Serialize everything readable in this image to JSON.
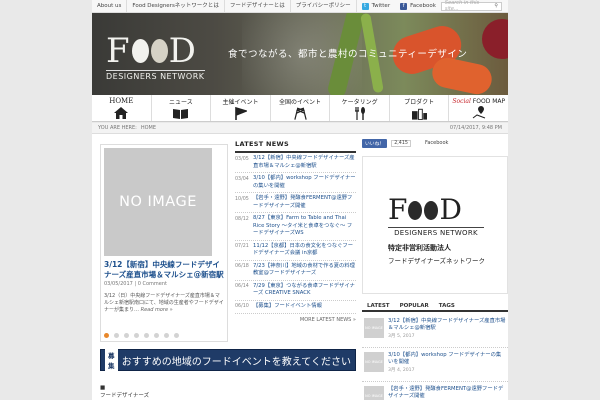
{
  "topbar": {
    "links": [
      "About us",
      "Food Designersネットワークとは",
      "フードデザイナーとは",
      "プライバシーポリシー"
    ],
    "twitter": "Twitter",
    "facebook": "Facebook",
    "search_placeholder": "Search in this site..."
  },
  "header": {
    "logo_word_left": "F",
    "logo_word_right": "D",
    "logo_sub": "DESIGNERS NETWORK",
    "tagline": "食でつながる、都市と農村のコミュニティーデザイン"
  },
  "nav": {
    "items": [
      {
        "label": "HOME",
        "icon": "house-icon"
      },
      {
        "label": "ニュース",
        "icon": "book-icon"
      },
      {
        "label": "主催イベント",
        "icon": "flag-icon"
      },
      {
        "label": "全国のイベント",
        "icon": "flags-icon"
      },
      {
        "label": "ケータリング",
        "icon": "cutlery-icon"
      },
      {
        "label": "プロダクト",
        "icon": "products-icon"
      },
      {
        "label_prefix": "Social",
        "label": "FOOD MAP",
        "icon": "map-pin-icon"
      }
    ]
  },
  "breadcrumb": {
    "prefix": "YOU ARE HERE:",
    "current": "HOME",
    "datetime": "07/14/2017, 9:48 PM"
  },
  "slider": {
    "placeholder": "NO IMAGE",
    "title": "3/12【新宿】中央線フードデザイナーズ産直市場＆マルシェ@新宿駅",
    "date": "03/05/2017",
    "comments": "0 Comment",
    "excerpt": "3/12（日）中央線フードデザイナーズ産直市場＆マルシェ新宿駅南口にて、地域の生産者やフードデザイナーが集まり…",
    "more": "Read more »",
    "dot_count": 8,
    "active_dot": 0
  },
  "latest_news": {
    "heading": "LATEST NEWS",
    "items": [
      {
        "date": "03/05",
        "title": "3/12【新宿】中央線フードデザイナーズ産直市場＆マルシェ@新宿駅"
      },
      {
        "date": "03/04",
        "title": "3/10【都内】workshop フードデザイナーの集いを開催"
      },
      {
        "date": "10/05",
        "title": "【岩手・遠野】発酵食FERMENT@遠野フードデザイナーズ開催"
      },
      {
        "date": "08/12",
        "title": "8/27【東京】Farm to Table and Thai Rice Story 〜タイ米と食卓をつなぐ〜 フードデザイナーズWS"
      },
      {
        "date": "07/21",
        "title": "11/12【京都】日本の食文化をつなぐフードデザイナーズ会議 in京都"
      },
      {
        "date": "06/18",
        "title": "7/23【神奈川】地域の食材で作る夏の料理教室@フードデザイナーズ"
      },
      {
        "date": "06/14",
        "title": "7/29【東京】つながる食卓フードデザイナーズ CREATIVE SNACK"
      },
      {
        "date": "06/10",
        "title": "【募集】フードイベント情報"
      }
    ],
    "more": "MORE LATEST NEWS »"
  },
  "cta_banner": {
    "tag": "募集",
    "text": "おすすめの地域のフードイベントを教えてください"
  },
  "below": {
    "line1": "■",
    "line2": "フードデザイナーズ"
  },
  "sidebar": {
    "fb_like": "いいね！",
    "fb_count": "2,415",
    "fb_share": "Facebook",
    "logo_word_left": "F",
    "logo_word_right": "D",
    "logo_sub": "DESIGNERS NETWORK",
    "logo_jp1": "特定非営利活動法人",
    "logo_jp2": "フードデザイナーズネットワーク",
    "tabs": [
      "LATEST",
      "POPULAR",
      "TAGS"
    ],
    "list": [
      {
        "title": "3/12【新宿】中央線フードデザイナーズ産直市場＆マルシェ@新宿駅",
        "date": "3月 5, 2017"
      },
      {
        "title": "3/10【都内】workshop フードデザイナーの集いを開催",
        "date": "3月 4, 2017"
      },
      {
        "title": "【岩手・遠野】発酵食FERMENT@遠野フードデザイナーズ開催",
        "date": "10月 5, 2016"
      }
    ],
    "thumb_label": "NO IMAGE"
  },
  "colors": {
    "link": "#1c4f8c",
    "accent": "#e8882c",
    "banner_blue": "#1f3b67"
  }
}
